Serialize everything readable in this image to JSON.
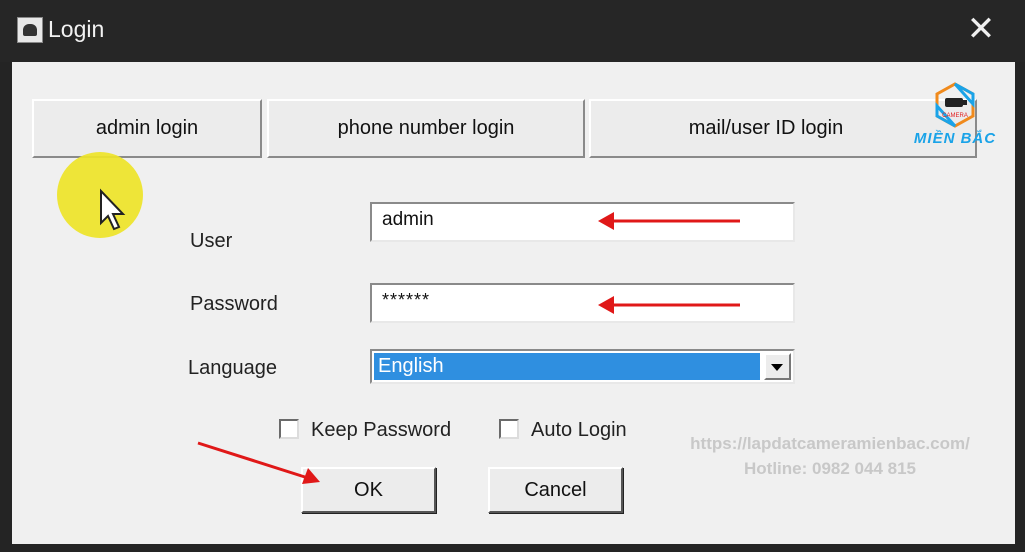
{
  "window": {
    "title": "Login",
    "close_glyph": "✕"
  },
  "tabs": [
    {
      "label": "admin login"
    },
    {
      "label": "phone number login"
    },
    {
      "label": "mail/user ID login"
    }
  ],
  "form": {
    "user_label": "User",
    "user_value": "admin",
    "password_label": "Password",
    "password_value": "******",
    "language_label": "Language",
    "language_value": "English",
    "keep_password_label": "Keep Password",
    "keep_password_checked": false,
    "auto_login_label": "Auto Login",
    "auto_login_checked": false
  },
  "buttons": {
    "ok": "OK",
    "cancel": "Cancel"
  },
  "watermark": {
    "url": "https://lapdatcameramienbac.com/",
    "hotline": "Hotline: 0982 044 815",
    "logo_text": "MIỀN BẮC",
    "logo_small": "CAMERA"
  },
  "colors": {
    "accent_selection": "#2f8fe0",
    "annotation_arrow": "#e01818",
    "cursor_highlight": "#eee428",
    "logo": "#1aa3e8"
  },
  "icons": [
    "app-icon",
    "close-icon",
    "chevron-down-icon",
    "mouse-cursor-icon",
    "camera-logo-icon"
  ]
}
